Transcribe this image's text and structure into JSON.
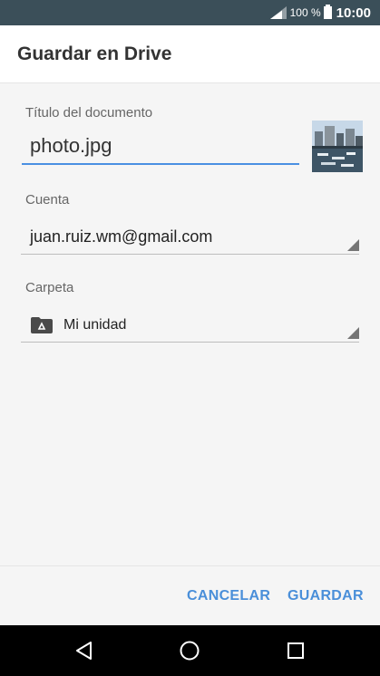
{
  "status_bar": {
    "battery_percent": "100 %",
    "time": "10:00",
    "signal_icon": "signal-icon",
    "battery_icon": "battery-icon"
  },
  "header": {
    "title": "Guardar en Drive"
  },
  "form": {
    "title_label": "Título del documento",
    "title_value": "photo.jpg",
    "account_label": "Cuenta",
    "account_value": "juan.ruiz.wm@gmail.com",
    "folder_label": "Carpeta",
    "folder_value": "Mi unidad",
    "folder_icon": "drive-folder-icon"
  },
  "actions": {
    "cancel_label": "CANCELAR",
    "save_label": "GUARDAR",
    "accent_color": "#4a8fd9"
  },
  "nav": {
    "back_icon": "back-icon",
    "home_icon": "home-icon",
    "recent_icon": "recent-apps-icon"
  }
}
